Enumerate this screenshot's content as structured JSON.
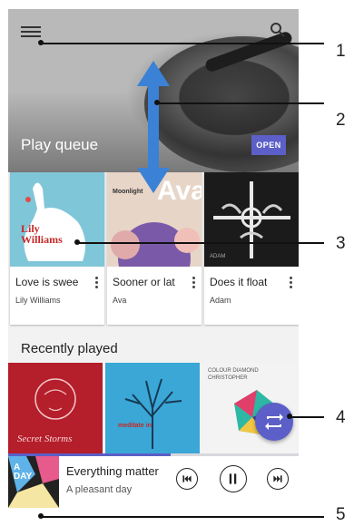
{
  "header": {
    "play_queue_title": "Play queue",
    "open_button": "OPEN"
  },
  "queue_cards": [
    {
      "title": "Love is swee",
      "artist": "Lily Williams",
      "art_text_1": "Lily",
      "art_text_2": "Williams"
    },
    {
      "title": "Sooner or lat",
      "artist": "Ava",
      "art_text_1": "Moonlight",
      "art_text_2": "Ava"
    },
    {
      "title": "Does it float",
      "artist": "Adam",
      "art_text_1": "ADAM"
    }
  ],
  "recently_played": {
    "title": "Recently played",
    "tile_texts": [
      "Secret Storms",
      "meditate in",
      "COLOUR DIAMOND CHRISTOPHER"
    ]
  },
  "player": {
    "title": "Everything matter",
    "subtitle": "A pleasant day",
    "progress": 0.56,
    "art_text": "A DAY"
  },
  "callouts": [
    "1",
    "2",
    "3",
    "4",
    "5"
  ],
  "colors": {
    "accent": "#5b5fc7",
    "arrow": "#3b82d6"
  },
  "icons": {
    "menu": "hamburger-menu-icon",
    "search": "search-icon",
    "shuffle": "repeat-icon",
    "prev": "skip-previous-icon",
    "pause": "pause-icon",
    "next": "skip-next-icon"
  }
}
